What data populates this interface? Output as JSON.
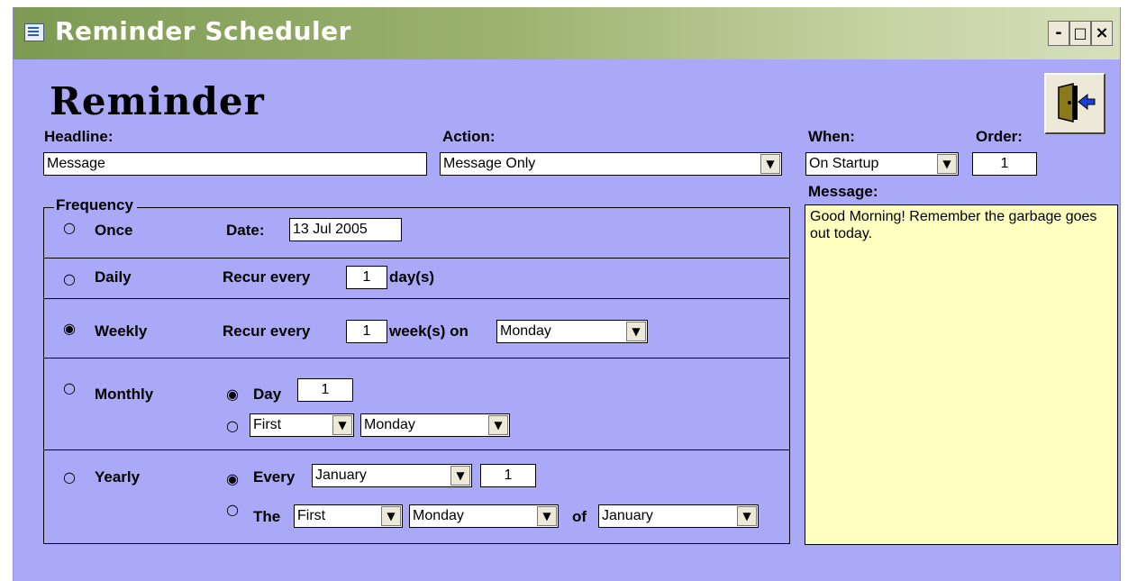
{
  "window": {
    "title": "Reminder Scheduler",
    "icon": "form-icon",
    "controls": {
      "minimize": "-",
      "maximize": "□",
      "close": "×"
    }
  },
  "form": {
    "title": "Reminder",
    "headline": {
      "label": "Headline:",
      "value": "Message"
    },
    "action": {
      "label": "Action:",
      "value": "Message Only"
    },
    "when": {
      "label": "When:",
      "value": "On Startup"
    },
    "order": {
      "label": "Order:",
      "value": "1"
    },
    "message": {
      "label": "Message:",
      "value": "Good Morning!  Remember the garbage goes out today."
    },
    "exit_icon": "exit-door-icon"
  },
  "frequency": {
    "legend": "Frequency",
    "selected": "Weekly",
    "once": {
      "label": "Once",
      "date_label": "Date:",
      "date_value": "13 Jul 2005"
    },
    "daily": {
      "label": "Daily",
      "recur_label": "Recur every",
      "recur_value": "1",
      "unit": "day(s)"
    },
    "weekly": {
      "label": "Weekly",
      "recur_label": "Recur every",
      "recur_value": "1",
      "unit": "week(s) on",
      "day": "Monday"
    },
    "monthly": {
      "label": "Monthly",
      "day_label": "Day",
      "day_value": "1",
      "selected_option": "Day",
      "ordinal": "First",
      "weekday": "Monday"
    },
    "yearly": {
      "label": "Yearly",
      "every_label": "Every",
      "every_month": "January",
      "every_day": "1",
      "selected_option": "Every",
      "the_label": "The",
      "ordinal": "First",
      "weekday": "Monday",
      "of_label": "of",
      "month": "January"
    }
  },
  "colors": {
    "form_background": "#a9a9f7",
    "message_background": "#ffffc0",
    "titlebar_start": "#7d9a53",
    "titlebar_end": "#d6dfbb"
  }
}
